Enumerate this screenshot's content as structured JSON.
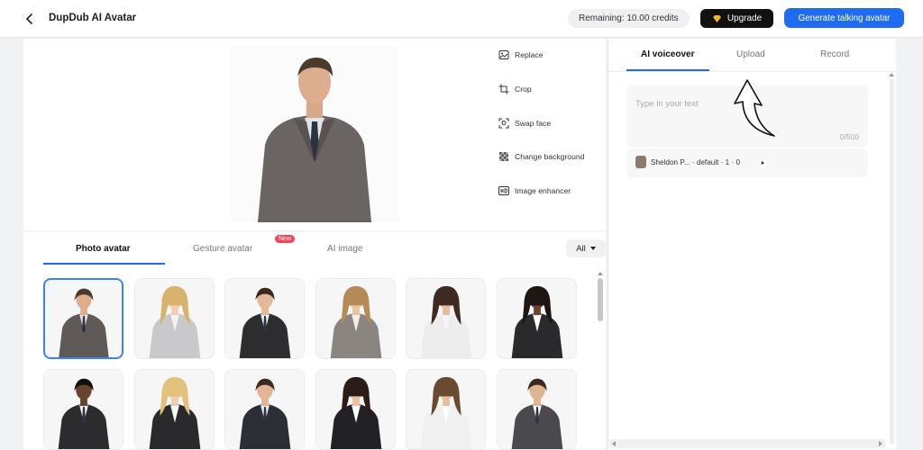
{
  "header": {
    "title": "DupDub AI Avatar",
    "credits": "Remaining: 10.00 credits",
    "upgrade_label": "Upgrade",
    "generate_label": "Generate talking avatar",
    "accent": "#1f6cf2"
  },
  "tools": [
    {
      "label": "Replace",
      "icon": "image-icon"
    },
    {
      "label": "Crop",
      "icon": "crop-icon"
    },
    {
      "label": "Swap face",
      "icon": "face-scan-icon"
    },
    {
      "label": "Change background",
      "icon": "checker-icon"
    },
    {
      "label": "Image enhancer",
      "icon": "hd-icon"
    }
  ],
  "avatar_tabs": {
    "items": [
      "Photo avatar",
      "Gesture avatar",
      "AI image"
    ],
    "active": "Photo avatar",
    "new_badge": "New",
    "filter_label": "All"
  },
  "voice_tabs": {
    "items": [
      "AI voiceover",
      "Upload",
      "Record"
    ],
    "active": "AI voiceover"
  },
  "script": {
    "placeholder": "Type in your text",
    "counter": "0/500"
  },
  "voice": {
    "label": "Sheldon P... · default · 1 · 0"
  }
}
